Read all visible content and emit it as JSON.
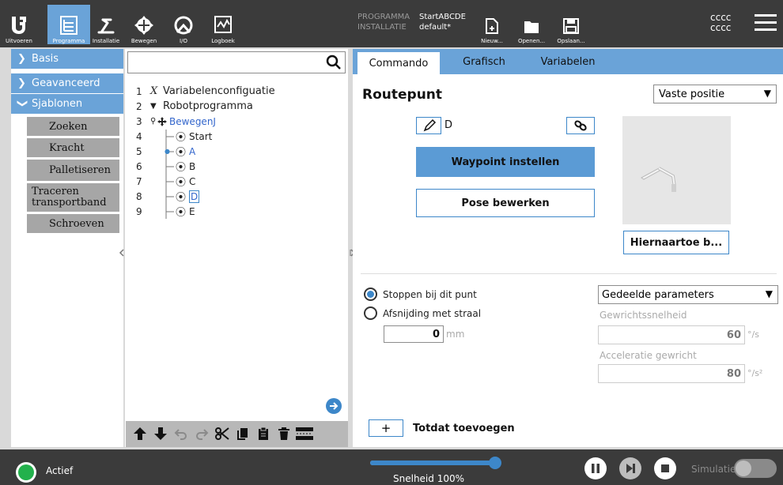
{
  "topbar": {
    "logo": "UR",
    "nav": [
      {
        "label": "Uitvoeren",
        "icon": "ur-logo-icon"
      },
      {
        "label": "Programma",
        "icon": "program-tree-icon"
      },
      {
        "label": "Installatie",
        "icon": "installation-icon"
      },
      {
        "label": "Bewegen",
        "icon": "move-icon"
      },
      {
        "label": "I/O",
        "icon": "io-icon"
      },
      {
        "label": "Logboek",
        "icon": "log-icon"
      }
    ],
    "program_label": "PROGRAMMA",
    "program_value": "StartABCDE",
    "install_label": "INSTALLATIE",
    "install_value": "default*",
    "file_buttons": [
      {
        "label": "Nieuw...",
        "icon": "new-file-icon"
      },
      {
        "label": "Openen...",
        "icon": "folder-icon"
      },
      {
        "label": "Opslaan...",
        "icon": "save-icon"
      }
    ],
    "user_line1": "cccc",
    "user_line2": "cccc"
  },
  "left": {
    "categories": [
      "Basis",
      "Geavanceerd",
      "Sjablonen"
    ],
    "templates": [
      "Zoeken",
      "Kracht",
      "Palletiseren",
      "Traceren transportband",
      "Schroeven"
    ]
  },
  "tree": {
    "search_value": "",
    "rows": [
      {
        "num": "1",
        "icon": "x-icon",
        "label": "Variabelenconfiguatie"
      },
      {
        "num": "2",
        "icon": "triangle-down-icon",
        "label": "Robotprogramma"
      },
      {
        "num": "3",
        "icon": "move-icon",
        "label": "BewegenJ"
      },
      {
        "num": "4",
        "icon": "waypoint-icon",
        "label": "Start"
      },
      {
        "num": "5",
        "icon": "waypoint-icon",
        "label": "A"
      },
      {
        "num": "6",
        "icon": "waypoint-icon",
        "label": "B"
      },
      {
        "num": "7",
        "icon": "waypoint-icon",
        "label": "C"
      },
      {
        "num": "8",
        "icon": "waypoint-icon",
        "label": "D"
      },
      {
        "num": "9",
        "icon": "waypoint-icon",
        "label": "E"
      }
    ]
  },
  "tabs": [
    "Commando",
    "Grafisch",
    "Variabelen"
  ],
  "command": {
    "title": "Routepunt",
    "position_type": "Vaste positie",
    "waypoint_name": "D",
    "set_waypoint": "Waypoint instellen",
    "edit_pose": "Pose bewerken",
    "move_here": "Hiernaartoe b...",
    "stop_option": "Stoppen bij dit punt",
    "blend_option": "Afsnijding met straal",
    "blend_value": "0",
    "blend_unit": "mm",
    "param_select": "Gedeelde parameters",
    "joint_speed_label": "Gewrichtssnelheid",
    "joint_speed_value": "60",
    "joint_speed_unit": "°/s",
    "joint_accel_label": "Acceleratie gewricht",
    "joint_accel_value": "80",
    "joint_accel_unit": "°/s²",
    "add_until_plus": "+",
    "add_until": "Totdat toevoegen"
  },
  "bottom": {
    "status": "Actief",
    "speed_label": "Snelheid 100%",
    "speed_fraction": 1.0,
    "simulation_label": "Simulatie",
    "colors": {
      "active_green": "#22b14c",
      "accent": "#6aa3d8",
      "slider": "#3d87c9"
    }
  }
}
